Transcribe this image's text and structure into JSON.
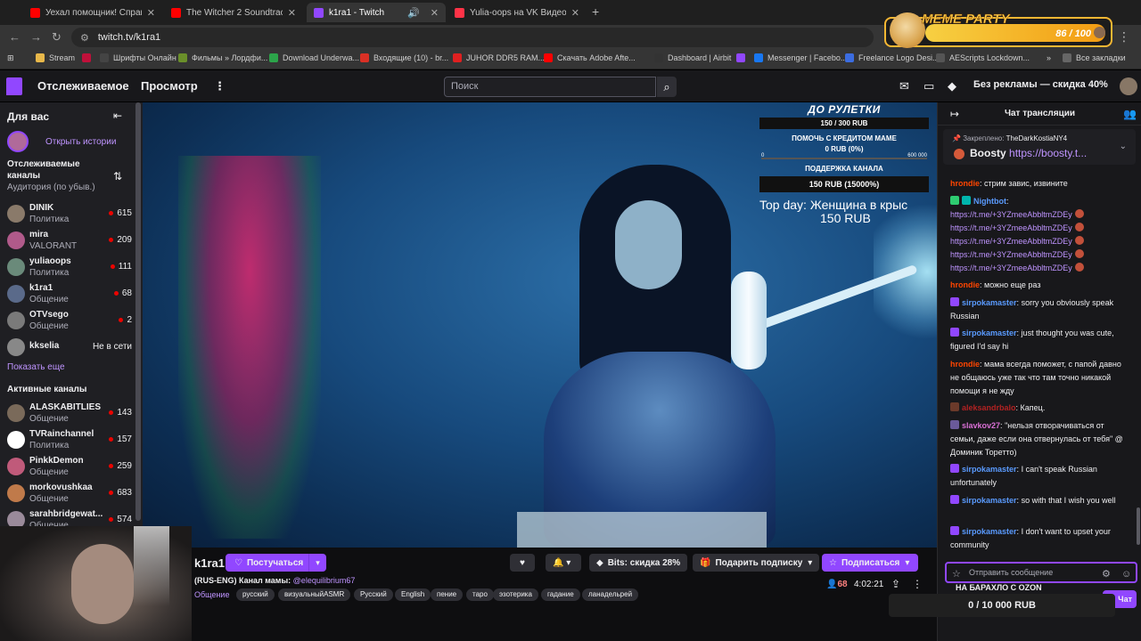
{
  "browser": {
    "tabs": [
      {
        "title": "Уехал помощник! Справляем",
        "favicon_color": "#ff0000"
      },
      {
        "title": "The Witcher 2 Soundtrack - So",
        "favicon_color": "#ff0000"
      },
      {
        "title": "k1ra1 - Twitch",
        "favicon_color": "#9147ff"
      },
      {
        "title": "Yulia-oops на VK Видео Live -",
        "favicon_color": "#ff3347"
      }
    ],
    "url": "twitch.tv/k1ra1",
    "bookmarks": [
      {
        "label": "Stream",
        "icon_color": "#e8b84a"
      },
      {
        "label": "",
        "icon_color": "#c0103a"
      },
      {
        "label": "Шрифты Онлайн",
        "icon_color": "#444"
      },
      {
        "label": "Фильмы » Лордфи...",
        "icon_color": "#6a8f2a"
      },
      {
        "label": "Download Underwa...",
        "icon_color": "#2ca44a"
      },
      {
        "label": "Входящие (10) - br...",
        "icon_color": "#d93025"
      },
      {
        "label": "JUHOR DDR5 RAM...",
        "icon_color": "#e02020"
      },
      {
        "label": "Скачать Adobe Afte...",
        "icon_color": "#ff0000"
      },
      {
        "label": "Dashboard | Airbit",
        "icon_color": "#333"
      },
      {
        "label": "",
        "icon_color": "#9147ff"
      },
      {
        "label": "Messenger | Facebo...",
        "icon_color": "#1877f2"
      },
      {
        "label": "Freelance Logo Desi...",
        "icon_color": "#3b6ce0"
      },
      {
        "label": "AEScripts Lockdown...",
        "icon_color": "#555"
      }
    ],
    "all_bookmarks": "Все закладки"
  },
  "meme_widget": {
    "title": "MEME PARTY",
    "count": "86 / 100"
  },
  "twitch_nav": {
    "following": "Отслеживаемое",
    "browse": "Просмотр",
    "search_placeholder": "Поиск",
    "adfree": "Без рекламы — скидка 40%"
  },
  "sidebar": {
    "heading": "Для вас",
    "stories": "Открыть истории",
    "followed_heading": "Отслеживаемые каналы",
    "followed_sub": "Аудитория (по убыв.)",
    "followed": [
      {
        "name": "DINIK",
        "category": "Политика",
        "viewers": "615",
        "avatar_color": "#8a7a6a"
      },
      {
        "name": "mira",
        "category": "VALORANT",
        "viewers": "209",
        "avatar_color": "#b05a8a"
      },
      {
        "name": "yuliaoops",
        "category": "Политика",
        "viewers": "111",
        "avatar_color": "#6a8a7a"
      },
      {
        "name": "k1ra1",
        "category": "Общение",
        "viewers": "68",
        "avatar_color": "#5a6a8a"
      },
      {
        "name": "OTVsego",
        "category": "Общение",
        "viewers": "2",
        "avatar_color": "#7a7a7a"
      },
      {
        "name": "kkselia",
        "category": "",
        "viewers": "Не в сети",
        "avatar_color": "#888"
      }
    ],
    "show_more": "Показать еще",
    "active_heading": "Активные каналы",
    "active": [
      {
        "name": "ALASKABITLIES",
        "category": "Общение",
        "viewers": "143",
        "avatar_color": "#7a6a5a"
      },
      {
        "name": "TVRainchannel",
        "category": "Политика",
        "viewers": "157",
        "avatar_color": "#ffffff"
      },
      {
        "name": "PinkkDemon",
        "category": "Общение",
        "viewers": "259",
        "avatar_color": "#c05a7a"
      },
      {
        "name": "morkovushkaa",
        "category": "Общение",
        "viewers": "683",
        "avatar_color": "#c07a4a"
      },
      {
        "name": "sarahbridgewat...",
        "category": "Общение",
        "viewers": "574",
        "avatar_color": "#9a8a9a"
      }
    ]
  },
  "overlay": {
    "roulette_heading": "ДО РУЛЕТКИ",
    "roulette_progress": "150 / 300 RUB",
    "credit_label": "ПОМОЧЬ С КРЕДИТОМ МАМЕ",
    "credit_value": "0 RUB (0%)",
    "credit_min": "0",
    "credit_max": "600 000",
    "support_label": "ПОДДЕРЖКА КАНАЛА",
    "support_value": "150 RUB (15000%)",
    "top_day": "Top day: Женщина в крыс",
    "top_day_amount": "150 RUB"
  },
  "stream": {
    "streamer": "k1ra1",
    "follow": "Постучаться",
    "bits": "Bits: скидка 28%",
    "gift": "Подарить подписку",
    "subscribe": "Подписаться",
    "title": "(RUS-ENG) Канал мамы:",
    "title_mention": "@elequilibrium67",
    "category": "Общение",
    "tags": [
      "русский",
      "визуальныйASMR",
      "Русский",
      "English",
      "пение",
      "таро",
      "эзотерика",
      "гадание",
      "ланадельрей"
    ],
    "viewers": "68",
    "uptime": "4:02:21"
  },
  "chat": {
    "title": "Чат трансляции",
    "pinned_label": "Закреплено:",
    "pinned_user": "TheDarkKostiaNY4",
    "pinned_text": "Boosty",
    "pinned_link": "https://boosty.t...",
    "messages": [
      {
        "user": "hrondie",
        "color": "#ff4500",
        "text": "стрим завис, извините"
      },
      {
        "user": "Nightbot",
        "color": "#5a9bff",
        "text": ""
      },
      {
        "user": "",
        "color": "",
        "text": "https://t.me/+3YZmeeAbbltmZDEy"
      },
      {
        "user": "",
        "color": "",
        "text": "https://t.me/+3YZmeeAbbltmZDEy"
      },
      {
        "user": "",
        "color": "",
        "text": "https://t.me/+3YZmeeAbbltmZDEy"
      },
      {
        "user": "",
        "color": "",
        "text": "https://t.me/+3YZmeeAbbltmZDEy"
      },
      {
        "user": "",
        "color": "",
        "text": "https://t.me/+3YZmeeAbbltmZDEy"
      },
      {
        "user": "hrondie",
        "color": "#ff4500",
        "text": "можно еще раз"
      },
      {
        "user": "sirpokamaster",
        "color": "#5a9bff",
        "text": "sorry you obviously speak Russian"
      },
      {
        "user": "sirpokamaster",
        "color": "#5a9bff",
        "text": "just thought you was cute, figured I'd say hi"
      },
      {
        "user": "hrondie",
        "color": "#ff4500",
        "text": "мама всегда поможет, с папой давно не общаюсь уже так что там точно никакой помощи я не жду"
      },
      {
        "user": "aleksandrbalo",
        "color": "#b22222",
        "text": "Капец."
      },
      {
        "user": "slavkov27",
        "color": "#da70d6",
        "text": "\"нельзя отворачиваться от семьи, даже если она отвернулась от тебя\" @ Доминик Торетто)"
      },
      {
        "user": "sirpokamaster",
        "color": "#5a9bff",
        "text": "I can't speak Russian unfortunately"
      },
      {
        "user": "sirpokamaster",
        "color": "#5a9bff",
        "text": "so with that I wish you well"
      },
      {
        "user": "sirpokamaster",
        "color": "#5a9bff",
        "text": "I don't want to upset your community"
      }
    ],
    "input_placeholder": "Отправить сообщение",
    "ozon": "НА БАРАХЛО С OZON",
    "send": "Чат",
    "donation": "0 / 10 000 RUB"
  }
}
